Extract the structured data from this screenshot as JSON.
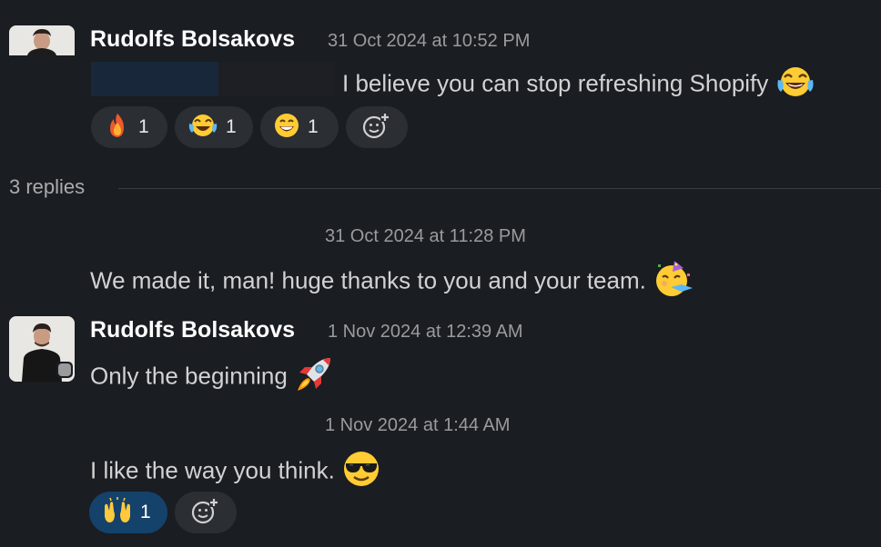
{
  "colors": {
    "background": "#1a1d21",
    "name": "#ffffff",
    "text": "#d1d2d3",
    "meta": "#9a9b9d",
    "reaction_bg": "#2b2e33",
    "reaction_active_bg": "#14426b"
  },
  "messages": [
    {
      "author": "Rudolfs Bolsakovs",
      "timestamp": "31 Oct 2024 at 10:52 PM",
      "text": "I believe you can stop refreshing Shopify",
      "emoji": "joy-emoji",
      "reactions": [
        {
          "emoji": "fire-emoji",
          "count": "1"
        },
        {
          "emoji": "joy-emoji",
          "count": "1"
        },
        {
          "emoji": "grin-emoji",
          "count": "1"
        }
      ]
    }
  ],
  "thread": {
    "replies_label": "3 replies",
    "replies": [
      {
        "timestamp": "31 Oct 2024 at 11:28 PM",
        "text": "We made it, man! huge thanks to you and your team.",
        "emoji": "partying-face-emoji"
      },
      {
        "author": "Rudolfs Bolsakovs",
        "timestamp": "1 Nov 2024 at 12:39 AM",
        "text": "Only the beginning",
        "emoji": "rocket-emoji",
        "presence": "away"
      },
      {
        "timestamp": "1 Nov 2024 at 1:44 AM",
        "text": "I like the way you think.",
        "emoji": "sunglasses-emoji",
        "reactions": [
          {
            "emoji": "raised-hands-emoji",
            "count": "1",
            "active": true
          }
        ]
      }
    ]
  }
}
